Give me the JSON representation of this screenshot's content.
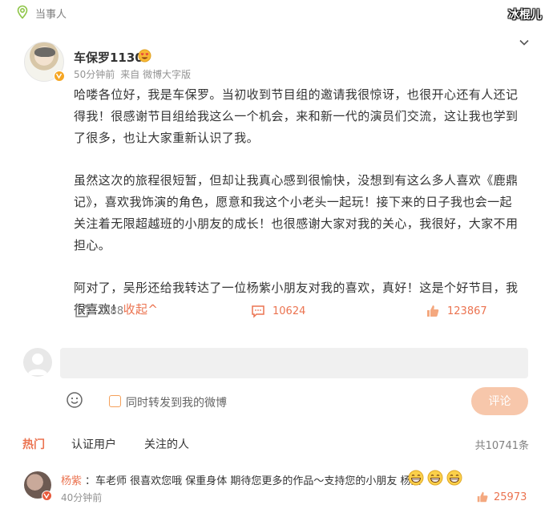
{
  "topbar": {
    "label": "当事人",
    "watermark": "冰棍儿"
  },
  "post": {
    "author": "车保罗1130",
    "time": "50分钟前",
    "source": "来自 微博大字版",
    "paragraphs": [
      "哈喽各位好，我是车保罗。当初收到节目组的邀请我很惊讶，也很开心还有人还记得我！很感谢节目组给我这么一个机会，来和新一代的演员们交流，这让我也学到了很多，也让大家重新认识了我。",
      "虽然这次的旅程很短暂，但却让我真心感到很愉快，没想到有这么多人喜欢《鹿鼎记》，喜欢我饰演的角色，愿意和我这个小老头一起玩！接下来的日子我也会一起关注着无限超越班的小朋友的成长！也很感谢大家对我的关心，我很好，大家不用担心。",
      "阿对了，吴彤还给我转达了一位杨紫小朋友对我的喜欢，真好！这是个好节目，我很喜欢！"
    ],
    "collapse_label": "收起^"
  },
  "actions": {
    "reposts": "2088",
    "comments": "10624",
    "likes": "123867"
  },
  "composer": {
    "repost_label": "同时转发到我的微博",
    "submit_label": "评论"
  },
  "tabs": [
    {
      "label": "热门",
      "active": true
    },
    {
      "label": "认证用户",
      "active": false
    },
    {
      "label": "关注的人",
      "active": false
    }
  ],
  "total_comments": "共10741条",
  "comments": [
    {
      "author": "杨紫",
      "text": "：车老师 很喜欢您哦 保重身体 期待您更多的作品～支持您的小朋友 杨紫",
      "emoji_count": 3,
      "time": "40分钟前",
      "likes": "25973"
    }
  ],
  "colors": {
    "accent": "#eb7350",
    "muted": "#808080",
    "input_bg": "#f0f0f0",
    "submit_bg": "#f7c7ab"
  }
}
